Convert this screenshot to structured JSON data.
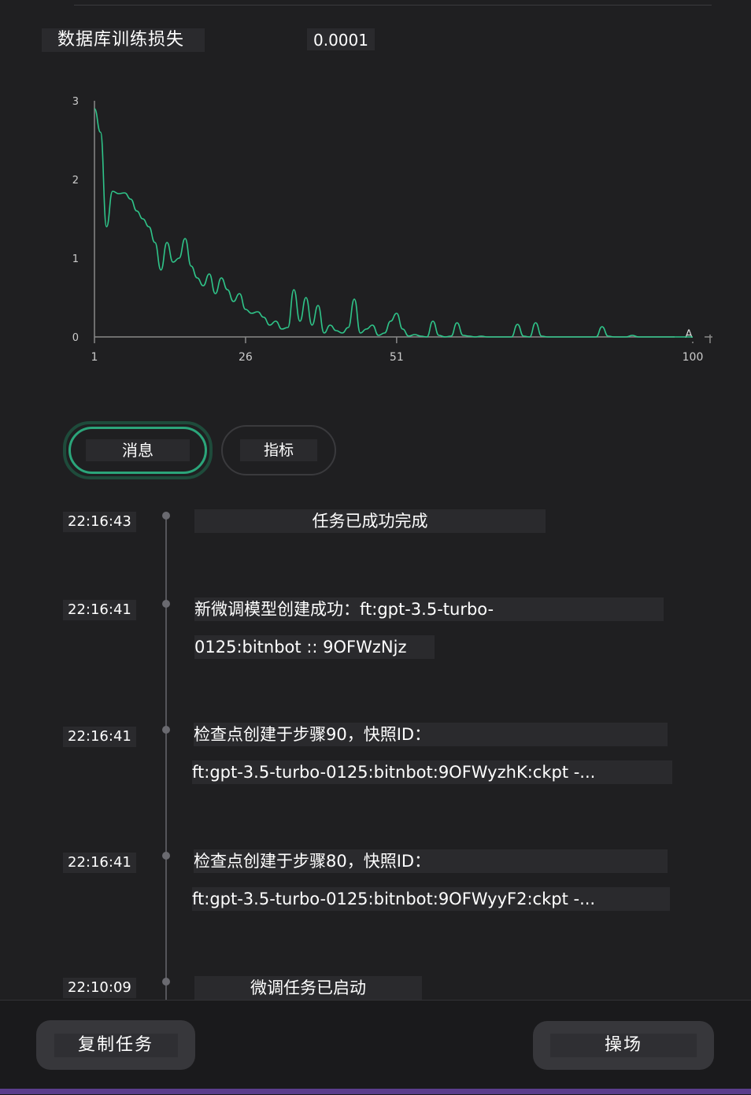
{
  "metric": {
    "label": "数据库训练损失",
    "value": "0.0001"
  },
  "chart_data": {
    "type": "line",
    "x_ticks": [
      "1",
      "26",
      "51",
      "100"
    ],
    "y_ticks": [
      "0",
      "1",
      "2",
      "3"
    ],
    "xlim": [
      1,
      100
    ],
    "ylim": [
      0,
      3
    ],
    "end_marker": "A",
    "line_color": "#2fc489",
    "series": [
      {
        "values": [
          2.9,
          2.6,
          1.4,
          1.85,
          1.82,
          1.83,
          1.75,
          1.6,
          1.5,
          1.4,
          1.2,
          0.85,
          1.2,
          0.95,
          1.0,
          1.25,
          0.9,
          0.75,
          0.65,
          0.8,
          0.55,
          0.75,
          0.6,
          0.45,
          0.55,
          0.35,
          0.3,
          0.32,
          0.25,
          0.15,
          0.2,
          0.1,
          0.12,
          0.6,
          0.2,
          0.5,
          0.15,
          0.4,
          0.05,
          0.15,
          0.08,
          0.05,
          0.12,
          0.48,
          0.05,
          0.1,
          0.15,
          0.02,
          0.05,
          0.2,
          0.3,
          0.1,
          0.01,
          0.03,
          0.01,
          0.0,
          0.2,
          0.02,
          0.0,
          0.01,
          0.18,
          0.02,
          0.01,
          0.0,
          0.01,
          0.0,
          0.0,
          0.0,
          0.0,
          0.0,
          0.16,
          0.01,
          0.0,
          0.18,
          0.01,
          0.0,
          0.0,
          0.0,
          0.0,
          0.0,
          0.0,
          0.0,
          0.0,
          0.0,
          0.13,
          0.01,
          0.0,
          0.0,
          0.0,
          0.02,
          0.0,
          0.0,
          0.0,
          0.0,
          0.0,
          0.0,
          0.0,
          0.0,
          0.0,
          0.0
        ]
      }
    ]
  },
  "tabs": {
    "messages": "消息",
    "metrics": "指标"
  },
  "events": [
    {
      "time": "22:16:43",
      "lines": [
        "任务已成功完成"
      ]
    },
    {
      "time": "22:16:41",
      "lines": [
        "新微调模型创建成功：ft:gpt-3.5-turbo-",
        "0125:bitnbot :: 9OFWzNjz"
      ]
    },
    {
      "time": "22:16:41",
      "lines": [
        "检查点创建于步骤90，快照ID：",
        "ft:gpt-3.5-turbo-0125:bitnbot:9OFWyzhK:ckpt -..."
      ]
    },
    {
      "time": "22:16:41",
      "lines": [
        "检查点创建于步骤80，快照ID：",
        "ft:gpt-3.5-turbo-0125:bitnbot:9OFWyyF2:ckpt -..."
      ]
    },
    {
      "time": "22:10:09",
      "lines": [
        "微调任务已启动"
      ]
    }
  ],
  "buttons": {
    "copy": "复制任务",
    "playground": "操场"
  },
  "colors": {
    "accent": "#2ba57a",
    "background": "#1f1f21"
  }
}
